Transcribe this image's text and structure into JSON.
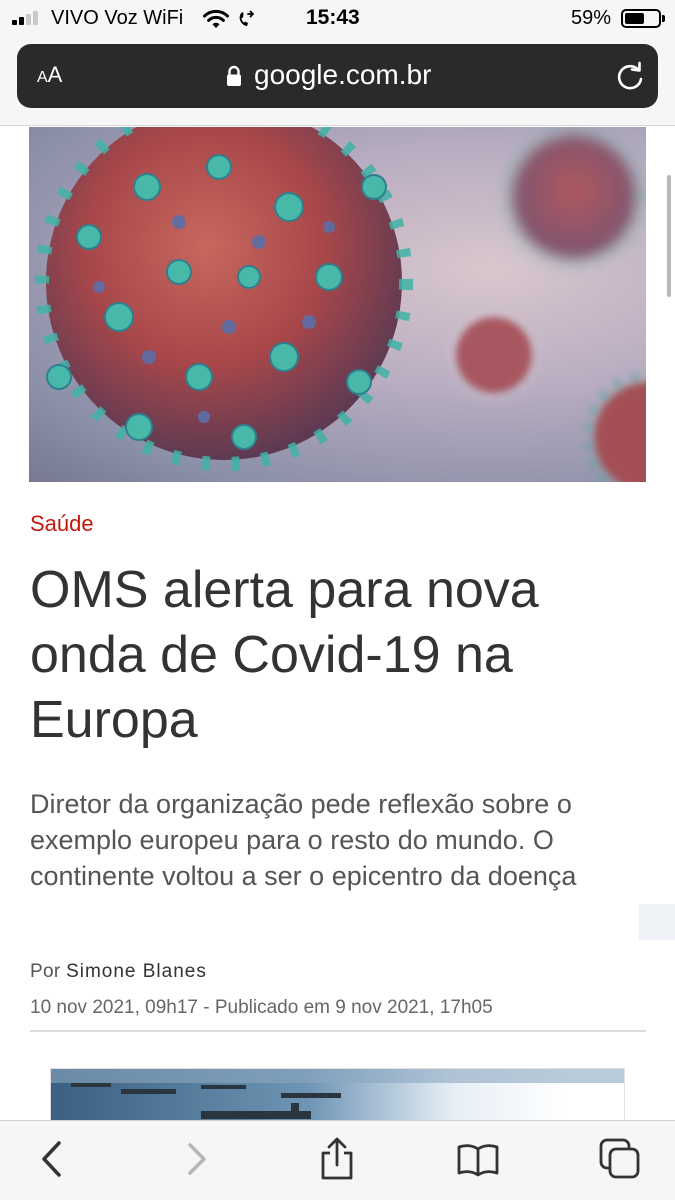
{
  "status_bar": {
    "carrier": "VIVO Voz WiFi",
    "time": "15:43",
    "battery_percent_text": "59%",
    "battery_level": 0.59,
    "signal_bars_active": 2,
    "icons": [
      "signal-icon",
      "wifi-icon",
      "call-forwarding-icon",
      "battery-icon"
    ]
  },
  "browser": {
    "text_size_label_small": "A",
    "text_size_label_large": "A",
    "url": "google.com.br",
    "icons": [
      "lock-icon",
      "reload-icon"
    ]
  },
  "article": {
    "hero_image": "coronavirus-illustration",
    "category": "Saúde",
    "headline": "OMS alerta para nova onda de Covid-19 na Europa",
    "subtitle": "Diretor da organização pede reflexão sobre o exemplo europeu para o resto do mundo. O continente voltou a ser o epicentro da doença",
    "byline_prefix": "Por",
    "author": "Simone Blanes",
    "dateline": "10 nov 2021, 09h17 - Publicado em 9 nov 2021, 17h05",
    "second_image": "ships-at-sea-photo"
  },
  "toolbar": {
    "icons": [
      "back-icon",
      "forward-icon",
      "share-icon",
      "bookmarks-icon",
      "tabs-icon"
    ]
  },
  "colors": {
    "category_red": "#c4170c",
    "address_bar_bg": "#2a2a2a",
    "headline_text": "#333333"
  }
}
